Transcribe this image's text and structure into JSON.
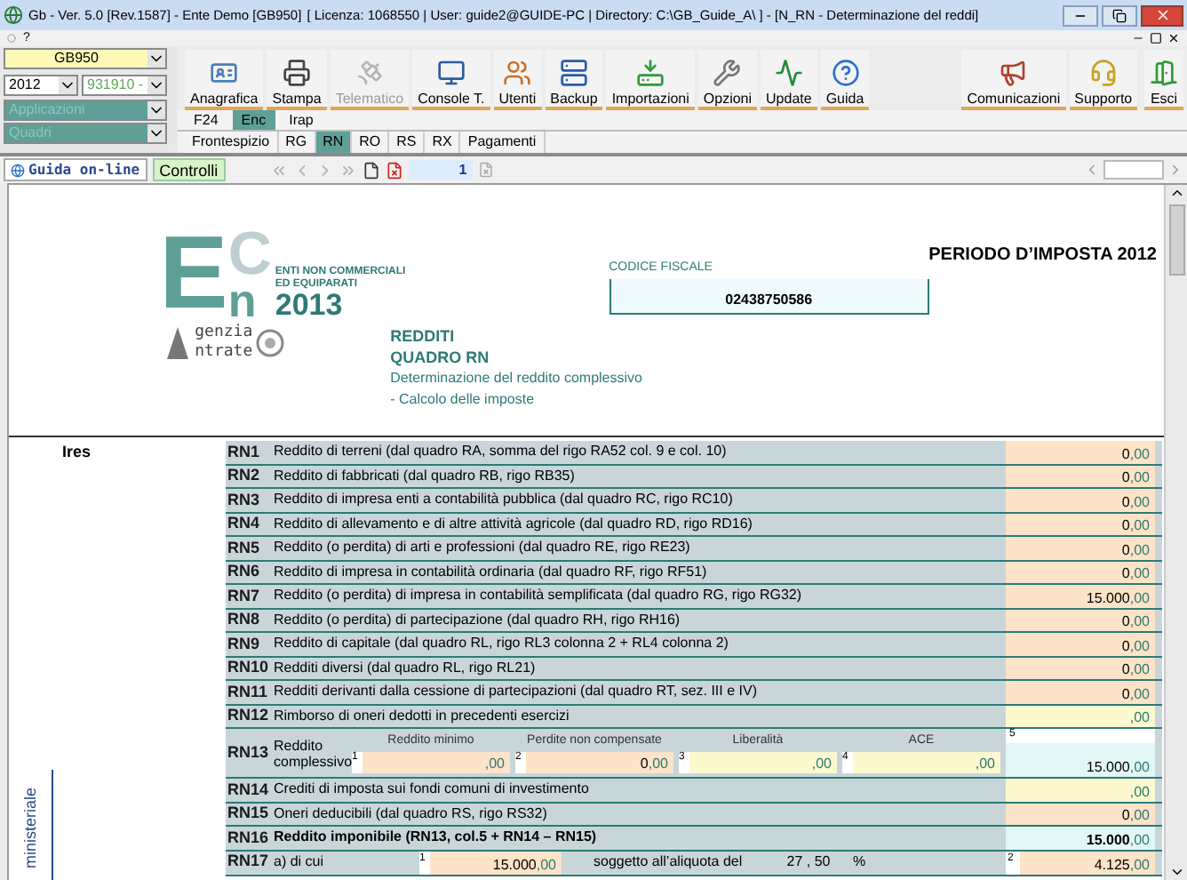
{
  "window": {
    "title": "Gb - Ver. 5.0 [Rev.1587] - Ente Demo [GB950]",
    "context": "[ Licenza: 1068550 | User: guide2@GUIDE-PC | Directory: C:\\GB_Guide_A\\ ] - [N_RN - Determinazione del reddi]"
  },
  "menu": [
    "?"
  ],
  "selectors": {
    "ente": "GB950",
    "year": "2012",
    "code": "931910 -",
    "applications": "Applicazioni",
    "sections": "Quadri"
  },
  "toolbar": {
    "main": [
      {
        "label": "Anagrafica",
        "disabled": false
      },
      {
        "label": "Stampa",
        "disabled": false
      },
      {
        "label": "Telematico",
        "disabled": true
      },
      {
        "label": "Console T.",
        "disabled": false
      },
      {
        "label": "Utenti",
        "disabled": false
      },
      {
        "label": "Backup",
        "disabled": false
      },
      {
        "label": "Importazioni",
        "disabled": false
      },
      {
        "label": "Opzioni",
        "disabled": false
      },
      {
        "label": "Update",
        "disabled": false
      },
      {
        "label": "Guida",
        "disabled": false
      }
    ],
    "extra": [
      {
        "label": "Comunicazioni",
        "disabled": false
      },
      {
        "label": "Supporto",
        "disabled": false
      }
    ],
    "exit": {
      "label": "Esci",
      "disabled": false
    }
  },
  "tabs": [
    {
      "label": "F24",
      "selected": false
    },
    {
      "label": "Enc",
      "selected": true
    },
    {
      "label": "Irap",
      "selected": false
    }
  ],
  "subtabs": [
    {
      "label": "Frontespizio",
      "selected": false
    },
    {
      "label": "RG",
      "selected": false
    },
    {
      "label": "RN",
      "selected": true
    },
    {
      "label": "RO",
      "selected": false
    },
    {
      "label": "RS",
      "selected": false
    },
    {
      "label": "RX",
      "selected": false
    },
    {
      "label": "Pagamenti",
      "selected": false
    }
  ],
  "navbar": {
    "help": "Guida on-line",
    "checks": "Controlli",
    "page": "1"
  },
  "form": {
    "period": "PERIODO D’IMPOSTA 2012",
    "logo": {
      "letters": [
        "E",
        "C",
        "n"
      ],
      "lines": [
        "ENTI NON COMMERCIALI",
        "ED EQUIPARATI"
      ],
      "year": "2013"
    },
    "agency": [
      "genzia",
      "ntrate"
    ],
    "tax_code": {
      "label": "CODICE FISCALE",
      "value": "02438750586"
    },
    "title": "REDDITI",
    "subtitle": "QUADRO RN",
    "description": [
      "Determinazione del reddito complessivo",
      "- Calcolo delle imposte"
    ],
    "section": "Ires",
    "side_label": "ministeriale",
    "rows": [
      {
        "kind": "line",
        "code": "RN1",
        "text": "Reddito di terreni (dal quadro RA, somma del rigo RA52 col. 9 e col. 10)",
        "amount": "0",
        "cents": ",00",
        "color": "#fde3c8"
      },
      {
        "kind": "line",
        "code": "RN2",
        "text": "Reddito di fabbricati (dal quadro RB, rigo RB35)",
        "amount": "0",
        "cents": ",00",
        "color": "#fde3c8"
      },
      {
        "kind": "line",
        "code": "RN3",
        "text": "Reddito di impresa enti a contabilità pubblica (dal quadro RC, rigo RC10)",
        "amount": "0",
        "cents": ",00",
        "color": "#fde3c8"
      },
      {
        "kind": "line",
        "code": "RN4",
        "text": "Reddito di allevamento e di altre attività agricole (dal quadro RD, rigo RD16)",
        "amount": "0",
        "cents": ",00",
        "color": "#fde3c8"
      },
      {
        "kind": "line",
        "code": "RN5",
        "text": "Reddito (o perdita) di arti e professioni (dal quadro RE, rigo RE23)",
        "amount": "0",
        "cents": ",00",
        "color": "#fde3c8"
      },
      {
        "kind": "line",
        "code": "RN6",
        "text": "Reddito di impresa in contabilità ordinaria (dal quadro RF, rigo RF51)",
        "amount": "0",
        "cents": ",00",
        "color": "#fde3c8"
      },
      {
        "kind": "line",
        "code": "RN7",
        "text": "Reddito (o perdita) di impresa in contabilità semplificata (dal quadro RG, rigo RG32)",
        "amount": "15.000",
        "cents": ",00",
        "color": "#fde3c8"
      },
      {
        "kind": "line",
        "code": "RN8",
        "text": "Reddito (o perdita) di partecipazione  (dal quadro RH, rigo RH16)",
        "amount": "0",
        "cents": ",00",
        "color": "#fde3c8"
      },
      {
        "kind": "line",
        "code": "RN9",
        "text": "Reddito di capitale (dal quadro RL, rigo RL3 colonna 2 + RL4 colonna 2)",
        "amount": "0",
        "cents": ",00",
        "color": "#fde3c8"
      },
      {
        "kind": "line",
        "code": "RN10",
        "text": "Redditi diversi (dal quadro RL, rigo RL21)",
        "amount": "0",
        "cents": ",00",
        "color": "#fde3c8"
      },
      {
        "kind": "line",
        "code": "RN11",
        "text": "Redditi derivanti dalla cessione di partecipazioni (dal quadro RT, sez. III e IV)",
        "amount": "0",
        "cents": ",00",
        "color": "#fde3c8"
      },
      {
        "kind": "line",
        "code": "RN12",
        "text": "Rimborso di oneri dedotti in precedenti esercizi",
        "cents": ",00",
        "color": "#fdf9cf"
      },
      {
        "kind": "split",
        "code": "RN13",
        "text": "Reddito complessivo",
        "fields": [
          {
            "label": "Reddito minimo",
            "index": "1",
            "cents": ",00",
            "color": "#fde3c8"
          },
          {
            "label": "Perdite non compensate",
            "index": "2",
            "amount": "0",
            "cents": ",00",
            "color": "#fde3c8"
          },
          {
            "label": "Liberalità",
            "index": "3",
            "cents": ",00",
            "color": "#fdf9cf"
          },
          {
            "label": "ACE",
            "index": "4",
            "cents": ",00",
            "color": "#fdf9cf"
          }
        ],
        "total": {
          "index": "5",
          "amount": "15.000",
          "cents": ",00",
          "color": "#e3f6f6"
        }
      },
      {
        "kind": "line",
        "code": "RN14",
        "text": "Crediti di imposta sui fondi comuni di investimento",
        "cents": ",00",
        "color": "#fdf9cf"
      },
      {
        "kind": "line",
        "code": "RN15",
        "text": "Oneri deducibili (dal quadro RS, rigo RS32)",
        "amount": "0",
        "cents": ",00",
        "color": "#fde3c8"
      },
      {
        "kind": "total",
        "code": "RN16",
        "text": "Reddito imponibile (RN13, col.5 + RN14 – RN15)",
        "amount": "15.000",
        "cents": ",00",
        "color": "#e3f6f6"
      },
      {
        "kind": "rate",
        "code": "RN17",
        "text": "a) di cui",
        "base": {
          "index": "1",
          "amount": "15.000",
          "cents": ",00",
          "color": "#fde3c8"
        },
        "rate_label": "soggetto all’aliquota del",
        "rate": "27 , 50",
        "percent": "%",
        "tax": {
          "index": "2",
          "amount": "4.125",
          "cents": ",00",
          "color": "#fde3c8"
        }
      }
    ]
  }
}
